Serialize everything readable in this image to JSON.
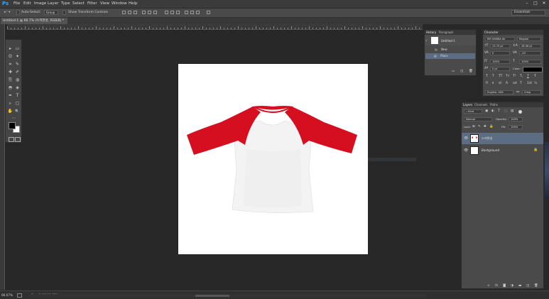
{
  "app": {
    "logo": "Ps"
  },
  "menu": [
    "File",
    "Edit",
    "Image",
    "Layer",
    "Type",
    "Select",
    "Filter",
    "View",
    "Window",
    "Help"
  ],
  "window_controls": {
    "minimize": "–",
    "maximize": "□",
    "close": "✕"
  },
  "options_bar": {
    "auto_select_label": "Auto-Select:",
    "auto_select_value": "Group",
    "show_transform_label": "Show Transform Controls",
    "workspace": "Essentials"
  },
  "document": {
    "tab_title": "Untitled-1 @ 66.7% (누끼완성, RGB/8) *"
  },
  "tools": [
    "▸",
    "▭",
    "ʘ",
    "✦",
    "⌗",
    "✎",
    "✚",
    "✐",
    "⎘",
    "◍",
    "◓",
    "◈",
    "✒",
    "T",
    "▹",
    "▢",
    "✋",
    "🔍",
    "⋯"
  ],
  "history_panel": {
    "tabs": [
      "History",
      "Paragraph"
    ],
    "snapshot": "Untitled-1",
    "states": [
      "New",
      "Place"
    ]
  },
  "character_panel": {
    "tab": "Character",
    "font_family": "BM HANNA Air",
    "font_style": "Regular",
    "font_size": "23.75 pt",
    "leading": "28.56 pt",
    "kerning": "0",
    "tracking": "-20",
    "vertical_scale": "100%",
    "horizontal_scale": "100%",
    "baseline_shift": "0 pt",
    "color_label": "Color:",
    "language": "English: USA",
    "antialias": "Crisp",
    "color_value": "#000000",
    "style_buttons": [
      "T",
      "T",
      "TT",
      "Tт",
      "T¹",
      "T,",
      "T",
      "Ŧ"
    ],
    "open_type_buttons": [
      "fi",
      "∂",
      "st",
      "A",
      "ad",
      "T",
      "1st",
      "½"
    ]
  },
  "layers_panel": {
    "tabs": [
      "Layers",
      "Channels",
      "Paths"
    ],
    "filter": "Kind",
    "blend_mode": "Normal",
    "opacity_label": "Opacity:",
    "opacity_value": "100%",
    "lock_label": "Lock:",
    "fill_label": "Fill:",
    "fill_value": "100%",
    "layers": [
      {
        "name": "누끼완성",
        "selected": true
      },
      {
        "name": "Background",
        "selected": false
      }
    ],
    "footer_icons": [
      "link-icon",
      "fx-icon",
      "mask-icon",
      "adjustment-icon",
      "folder-icon",
      "new-layer-icon",
      "trash-icon"
    ]
  },
  "status": {
    "zoom": "66.67%",
    "doc_info": "Doc: 2.00M/1.55M"
  },
  "colors": {
    "foreground": "#000000",
    "background": "#ffffff",
    "accent": "#31a8ff",
    "selection": "#5c6d82"
  }
}
